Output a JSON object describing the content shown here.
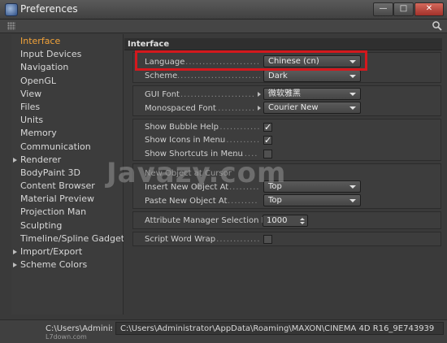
{
  "window": {
    "title": "Preferences",
    "close_glyph": "✕",
    "min_glyph": "—",
    "max_glyph": "□"
  },
  "sidebar": {
    "items": [
      {
        "label": "Interface",
        "active": true,
        "expandable": false
      },
      {
        "label": "Input Devices",
        "active": false,
        "expandable": false
      },
      {
        "label": "Navigation",
        "active": false,
        "expandable": false
      },
      {
        "label": "OpenGL",
        "active": false,
        "expandable": false
      },
      {
        "label": "View",
        "active": false,
        "expandable": false
      },
      {
        "label": "Files",
        "active": false,
        "expandable": false
      },
      {
        "label": "Units",
        "active": false,
        "expandable": false
      },
      {
        "label": "Memory",
        "active": false,
        "expandable": false
      },
      {
        "label": "Communication",
        "active": false,
        "expandable": false
      },
      {
        "label": "Renderer",
        "active": false,
        "expandable": true
      },
      {
        "label": "BodyPaint 3D",
        "active": false,
        "expandable": false
      },
      {
        "label": "Content Browser",
        "active": false,
        "expandable": false
      },
      {
        "label": "Material Preview",
        "active": false,
        "expandable": false
      },
      {
        "label": "Projection Man",
        "active": false,
        "expandable": false
      },
      {
        "label": "Sculpting",
        "active": false,
        "expandable": false
      },
      {
        "label": "Timeline/Spline Gadget",
        "active": false,
        "expandable": false
      },
      {
        "label": "Import/Export",
        "active": false,
        "expandable": true
      },
      {
        "label": "Scheme Colors",
        "active": false,
        "expandable": true
      }
    ]
  },
  "main": {
    "section_title": "Interface",
    "language": {
      "label": "Language",
      "value": "Chinese (cn)"
    },
    "scheme": {
      "label": "Scheme",
      "value": "Dark"
    },
    "gui_font": {
      "label": "GUI Font",
      "value": "微软雅黑"
    },
    "monospaced_font": {
      "label": "Monospaced Font",
      "value": "Courier New"
    },
    "show_bubble_help": {
      "label": "Show Bubble Help",
      "checked": true
    },
    "show_icons_in_menu": {
      "label": "Show Icons in Menu",
      "checked": true
    },
    "show_shortcuts_in_menu": {
      "label": "Show Shortcuts in Menu",
      "checked": false
    },
    "insert_new_object_at": {
      "label": "Insert New Object At",
      "value": "Top"
    },
    "paste_new_object_at": {
      "label": "Paste New Object At",
      "value": "Top"
    },
    "attribute_manager_selection_limit": {
      "label": "Attribute Manager Selection Limit",
      "value": "1000"
    },
    "script_word_wrap": {
      "label": "Script Word Wrap",
      "checked": false
    },
    "partial_row_text": "New Object at Cursor"
  },
  "status": {
    "label": "C:\\Users\\Administrator",
    "path": "C:\\Users\\Administrator\\AppData\\Roaming\\MAXON\\CINEMA 4D R16_9E743939",
    "sub": "L7down.com"
  },
  "overlay": {
    "watermark": "Javazy.com",
    "highlight_color": "#d4181d"
  },
  "icons": {
    "app": "cinema4d-icon",
    "grip": "grip-dots-icon",
    "search": "search-icon",
    "check": "✓"
  },
  "colors": {
    "accent": "#f2a33a",
    "background": "#3a3a3a"
  }
}
